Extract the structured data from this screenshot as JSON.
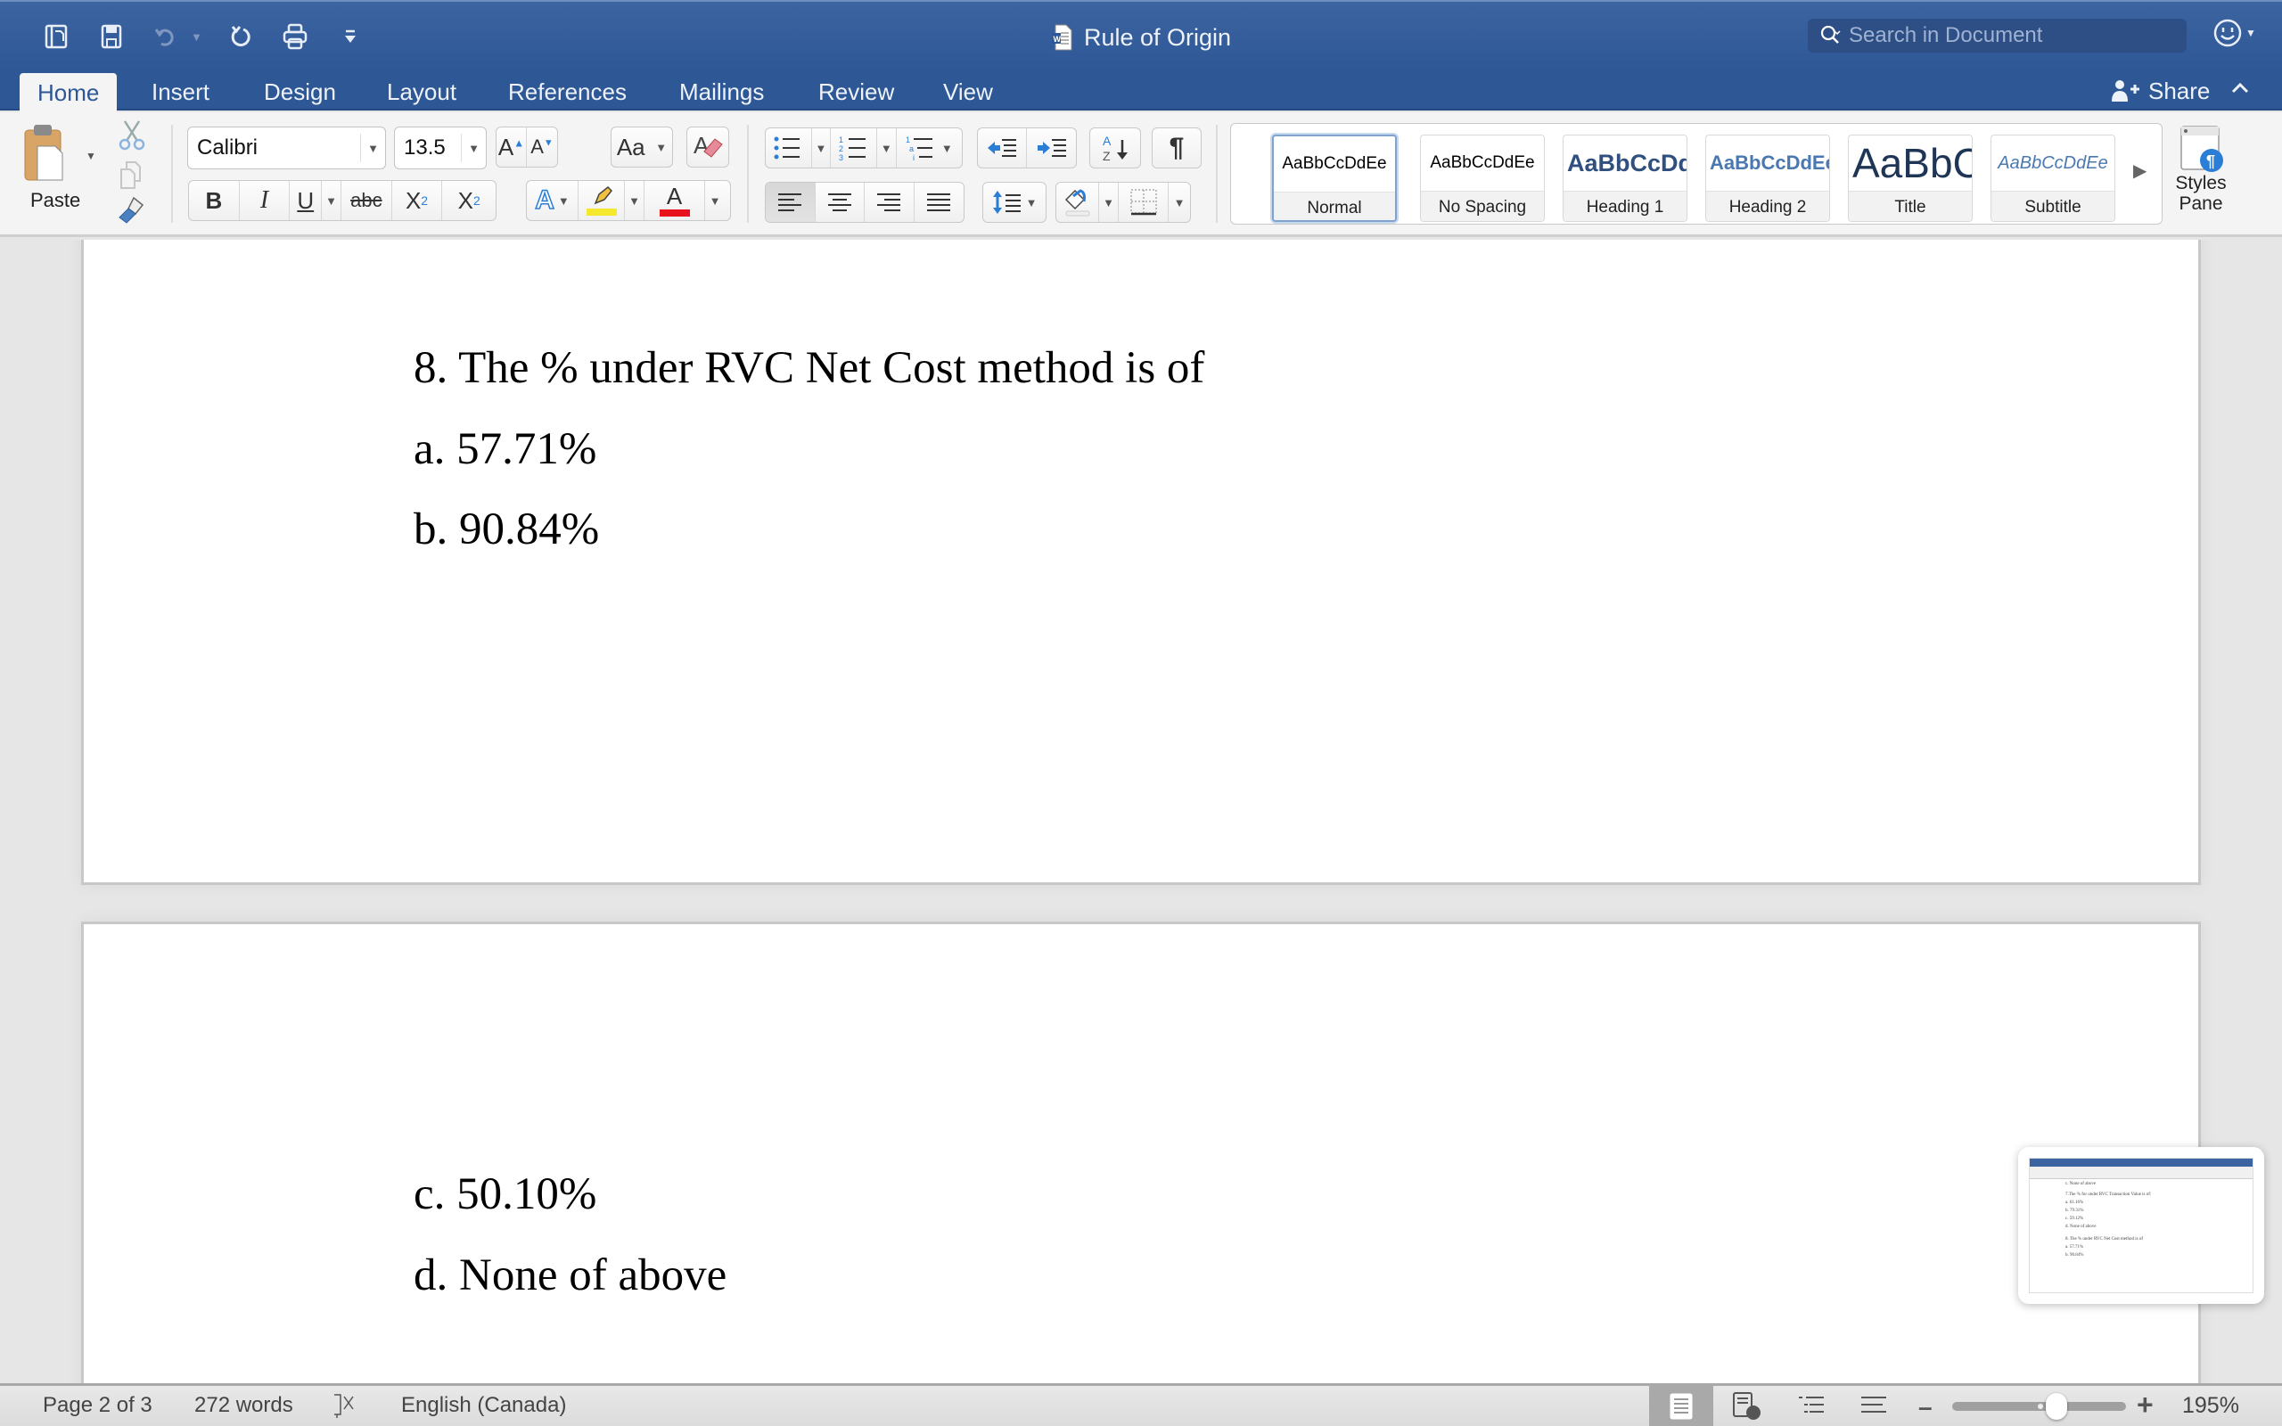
{
  "app": {
    "document_title": "Rule of Origin",
    "quick_access": [
      "sidebar-toggle-icon",
      "save-icon",
      "undo-icon",
      "redo-icon",
      "print-icon",
      "customize-toolbar-icon"
    ]
  },
  "search": {
    "placeholder": "Search in Document",
    "value": ""
  },
  "tabs": [
    {
      "label": "Home",
      "active": true
    },
    {
      "label": "Insert"
    },
    {
      "label": "Design"
    },
    {
      "label": "Layout"
    },
    {
      "label": "References"
    },
    {
      "label": "Mailings"
    },
    {
      "label": "Review"
    },
    {
      "label": "View"
    }
  ],
  "share_label": "Share",
  "ribbon": {
    "paste_label": "Paste",
    "font_name": "Calibri",
    "font_size": "13.5",
    "styles": [
      {
        "sample": "AaBbCcDdEe",
        "label": "Normal",
        "selected": true,
        "color": "#000000"
      },
      {
        "sample": "AaBbCcDdEe",
        "label": "No Spacing",
        "color": "#000000"
      },
      {
        "sample": "AaBbCcDd",
        "label": "Heading 1",
        "color": "#2f4f7f"
      },
      {
        "sample": "AaBbCcDdEe",
        "label": "Heading 2",
        "color": "#4a78b0"
      },
      {
        "sample": "AaBbC",
        "label": "Title",
        "color": "#1f3556"
      },
      {
        "sample": "AaBbCcDdEe",
        "label": "Subtitle",
        "color": "#4a78b0"
      }
    ],
    "styles_pane_label_1": "Styles",
    "styles_pane_label_2": "Pane",
    "font_color": "#e8121c",
    "highlight_color": "#f5e92f"
  },
  "document": {
    "page1_lines": [
      "8. The % under RVC Net Cost method is of",
      "a. 57.71%",
      "b. 90.84%"
    ],
    "page2_lines": [
      "c. 50.10%",
      "d. None of above"
    ]
  },
  "thumbnail": {
    "lines": [
      "c. None of above",
      "7.The % for under RVC Transaction Value is of:",
      "a. 61.16%",
      "b. 79.31%",
      "c. 59.12%",
      "d. None of above",
      "8. The % under RVC Net Cost method is of",
      "a. 57.71%",
      "b. 90.84%"
    ]
  },
  "status": {
    "page": "Page 2 of 3",
    "words": "272 words",
    "language": "English (Canada)",
    "zoom": "195%",
    "zoom_slider_fraction": 0.6
  }
}
